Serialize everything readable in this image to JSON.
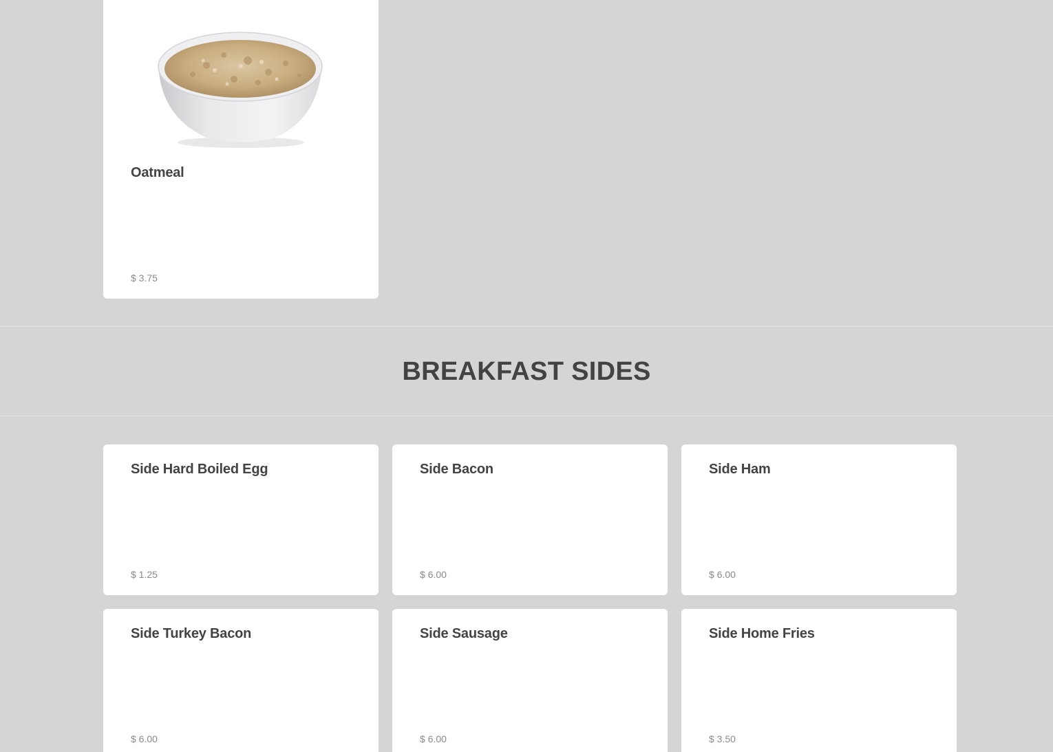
{
  "featured_item": {
    "name": "Oatmeal",
    "price": "$ 3.75",
    "image_icon": "oatmeal-bowl-image"
  },
  "section": {
    "title": "BREAKFAST SIDES"
  },
  "items": [
    {
      "name": "Side Hard Boiled Egg",
      "price": "$ 1.25"
    },
    {
      "name": "Side Bacon",
      "price": "$ 6.00"
    },
    {
      "name": "Side Ham",
      "price": "$ 6.00"
    },
    {
      "name": "Side Turkey Bacon",
      "price": "$ 6.00"
    },
    {
      "name": "Side Sausage",
      "price": "$ 6.00"
    },
    {
      "name": "Side Home Fries",
      "price": "$ 3.50"
    }
  ],
  "colors": {
    "background": "#d4d5d7",
    "card": "#ffffff",
    "title_text": "#434343",
    "price_text": "#8a8a8a"
  }
}
